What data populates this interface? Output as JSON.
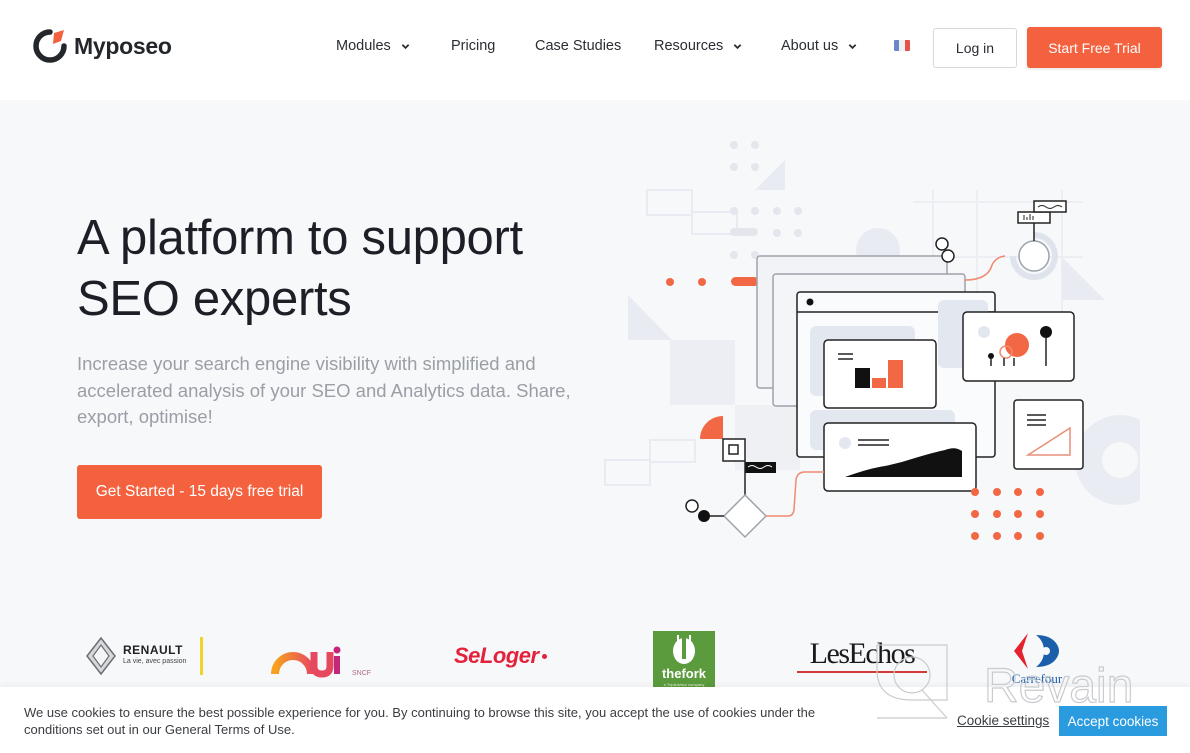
{
  "header": {
    "brand": "Myposeo",
    "nav": [
      {
        "label": "Modules",
        "has_dropdown": true
      },
      {
        "label": "Pricing",
        "has_dropdown": false
      },
      {
        "label": "Case Studies",
        "has_dropdown": false
      },
      {
        "label": "Resources",
        "has_dropdown": true
      },
      {
        "label": "About us",
        "has_dropdown": true
      }
    ],
    "language_flag": "fr-flag",
    "login_label": "Log in",
    "trial_label": "Start Free Trial"
  },
  "hero": {
    "title_line1": "A platform to support",
    "title_line2": "SEO experts",
    "subtitle": "Increase your search engine visibility with simplified and accelerated analysis of your SEO and Analytics data. Share, export, optimise!",
    "cta_label": "Get Started - 15 days free trial"
  },
  "logos": {
    "renault": {
      "name": "RENAULT",
      "tagline": "La vie, avec passion"
    },
    "oui": {
      "name": "Oui",
      "suffix": "SNCF"
    },
    "seloger": {
      "name": "SeLoger"
    },
    "thefork": {
      "name": "thefork",
      "tagline": "a TripAdvisor company"
    },
    "lesechos": {
      "name": "LesEchos"
    },
    "carrefour": {
      "name": "Carrefour"
    }
  },
  "cookie_bar": {
    "text": "We use cookies to ensure the best possible experience for you. By continuing to browse this site, you accept the use of cookies under the conditions set out in our General Terms of Use.",
    "settings_label": "Cookie settings",
    "accept_label": "Accept cookies"
  },
  "watermark": "Revain",
  "colors": {
    "accent": "#f4613f",
    "cookie_accept": "#2b9be0",
    "text_dark": "#1c2026",
    "text_muted": "#9a9ea5"
  }
}
